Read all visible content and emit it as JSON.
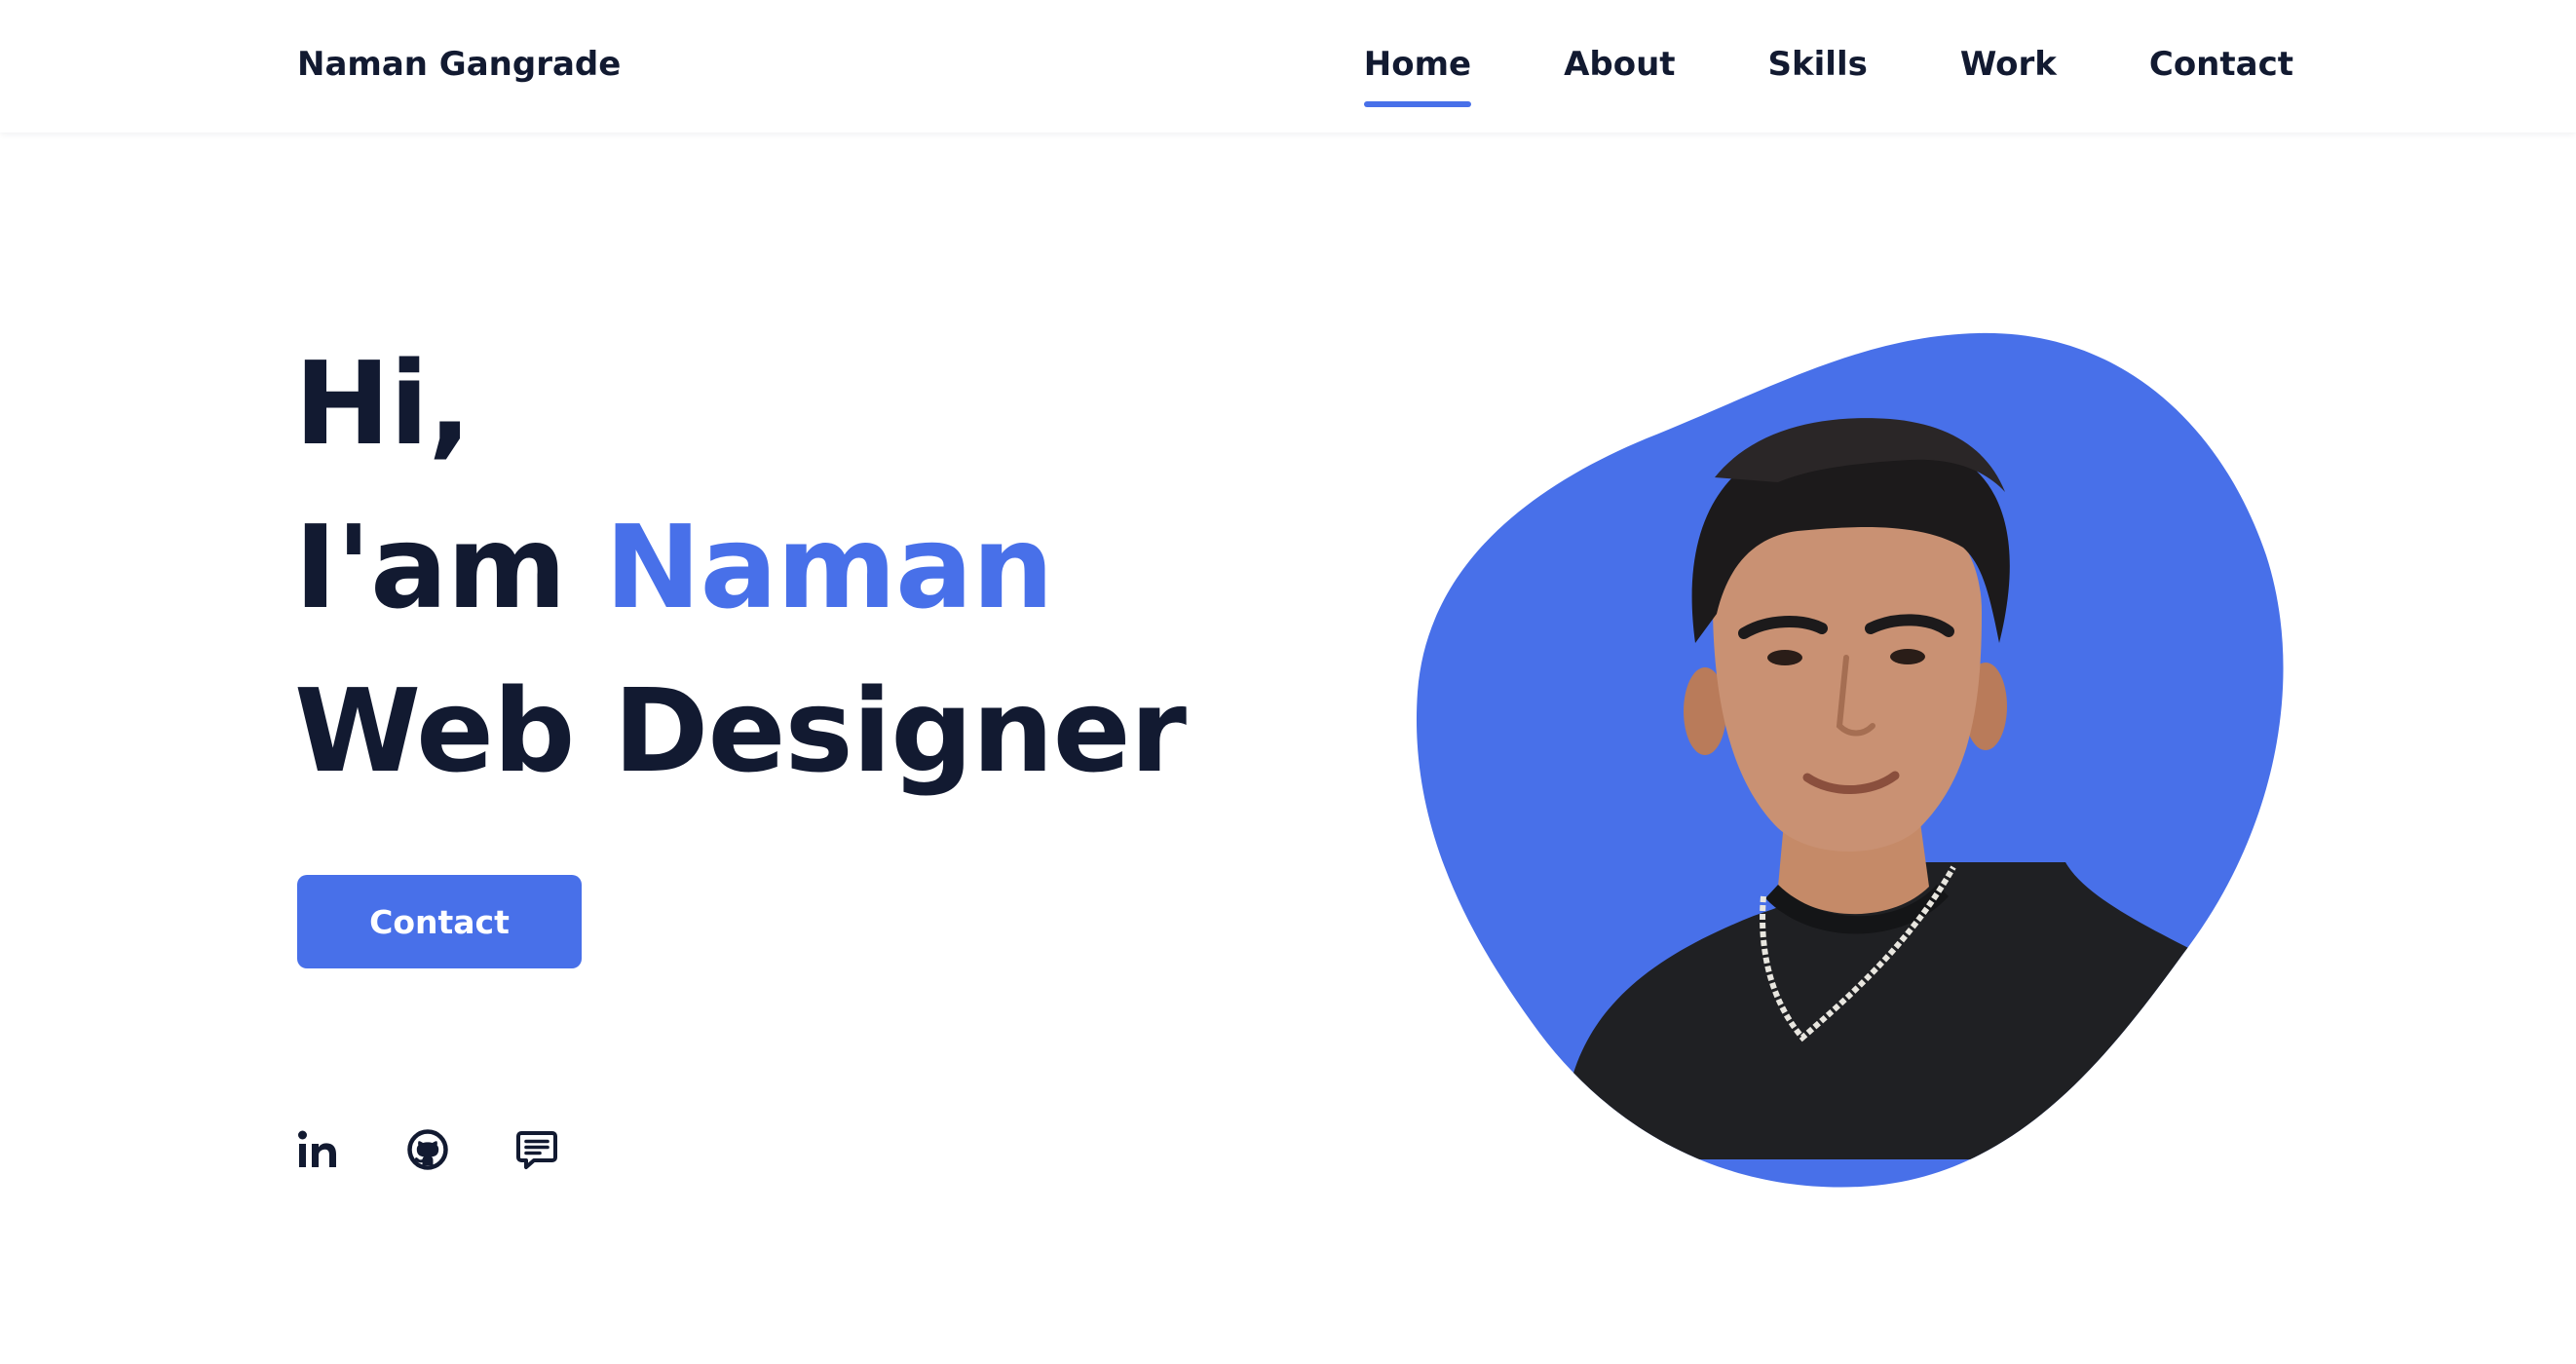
{
  "header": {
    "logo": "Naman Gangrade",
    "nav": [
      {
        "label": "Home",
        "active": true
      },
      {
        "label": "About",
        "active": false
      },
      {
        "label": "Skills",
        "active": false
      },
      {
        "label": "Work",
        "active": false
      },
      {
        "label": "Contact",
        "active": false
      }
    ]
  },
  "hero": {
    "greeting": "Hi,",
    "intro_prefix": "I'am ",
    "name": "Naman",
    "role": "Web Designer",
    "button_label": "Contact"
  },
  "social": {
    "icons": [
      "linkedin-icon",
      "github-icon",
      "message-icon"
    ]
  },
  "colors": {
    "accent": "#4870e9",
    "text": "#121a31",
    "background": "#ffffff",
    "shirt": "#1f2023"
  }
}
